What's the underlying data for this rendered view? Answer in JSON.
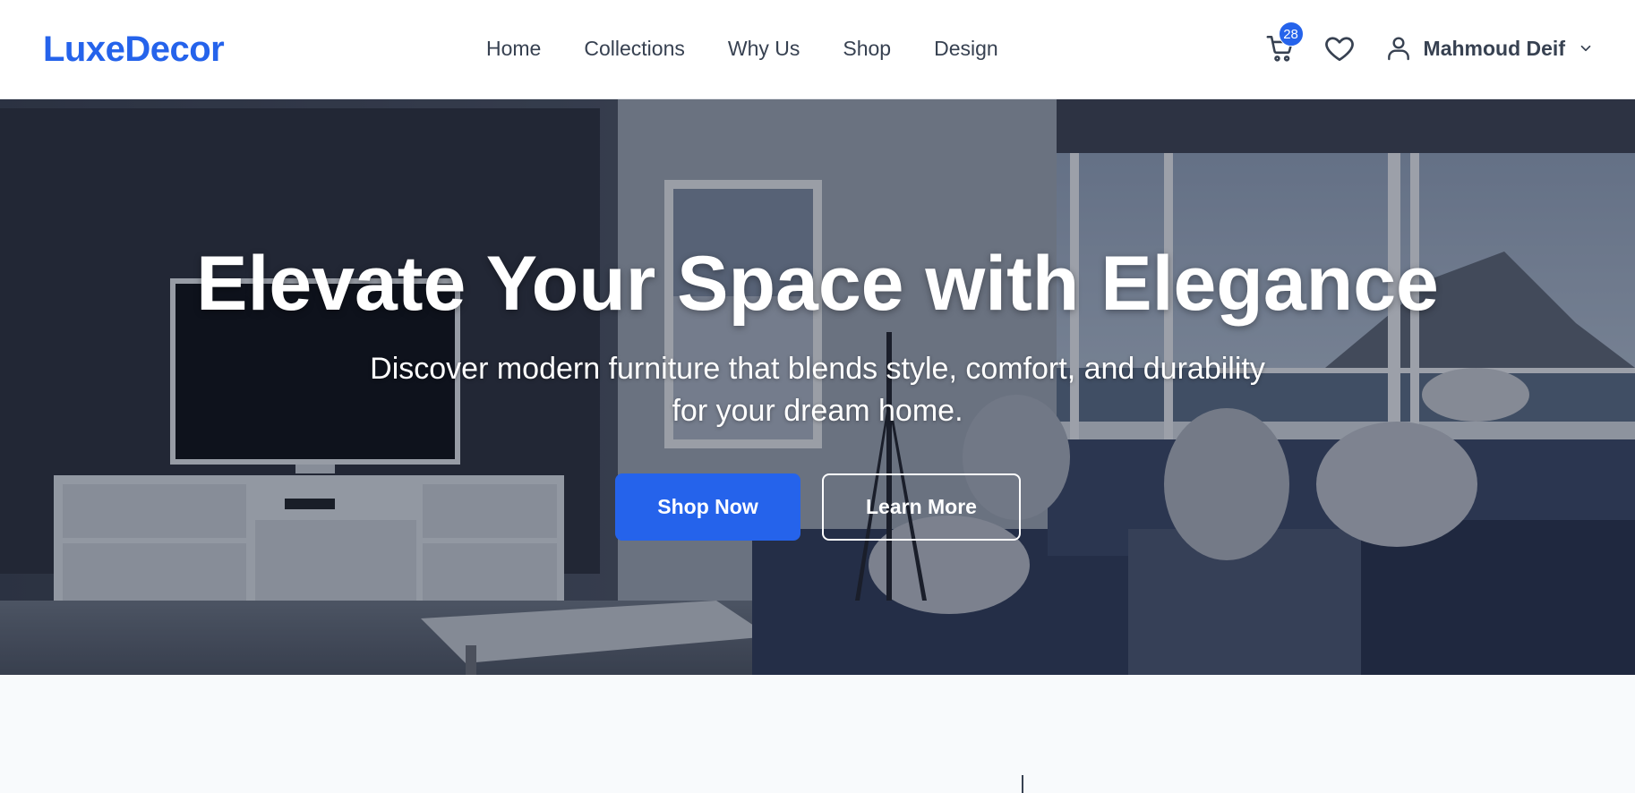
{
  "brand": {
    "name": "LuxeDecor",
    "color": "#2563eb"
  },
  "nav": {
    "links": [
      {
        "label": "Home"
      },
      {
        "label": "Collections"
      },
      {
        "label": "Why Us"
      },
      {
        "label": "Shop"
      },
      {
        "label": "Design"
      }
    ]
  },
  "actions": {
    "cart": {
      "icon": "cart-icon",
      "count": "28"
    },
    "wishlist": {
      "icon": "heart-icon"
    },
    "user": {
      "icon": "user-icon",
      "name": "Mahmoud Deif",
      "dropdown_icon": "chevron-down-icon"
    }
  },
  "hero": {
    "title": "Elevate Your Space with Elegance",
    "subtitle": "Discover modern furniture that blends style, comfort, and durability for your dream home.",
    "primary_button": "Shop Now",
    "secondary_button": "Learn More"
  },
  "colors": {
    "accent": "#2563eb",
    "nav_text": "#374151",
    "page_background": "#f8fafc"
  }
}
